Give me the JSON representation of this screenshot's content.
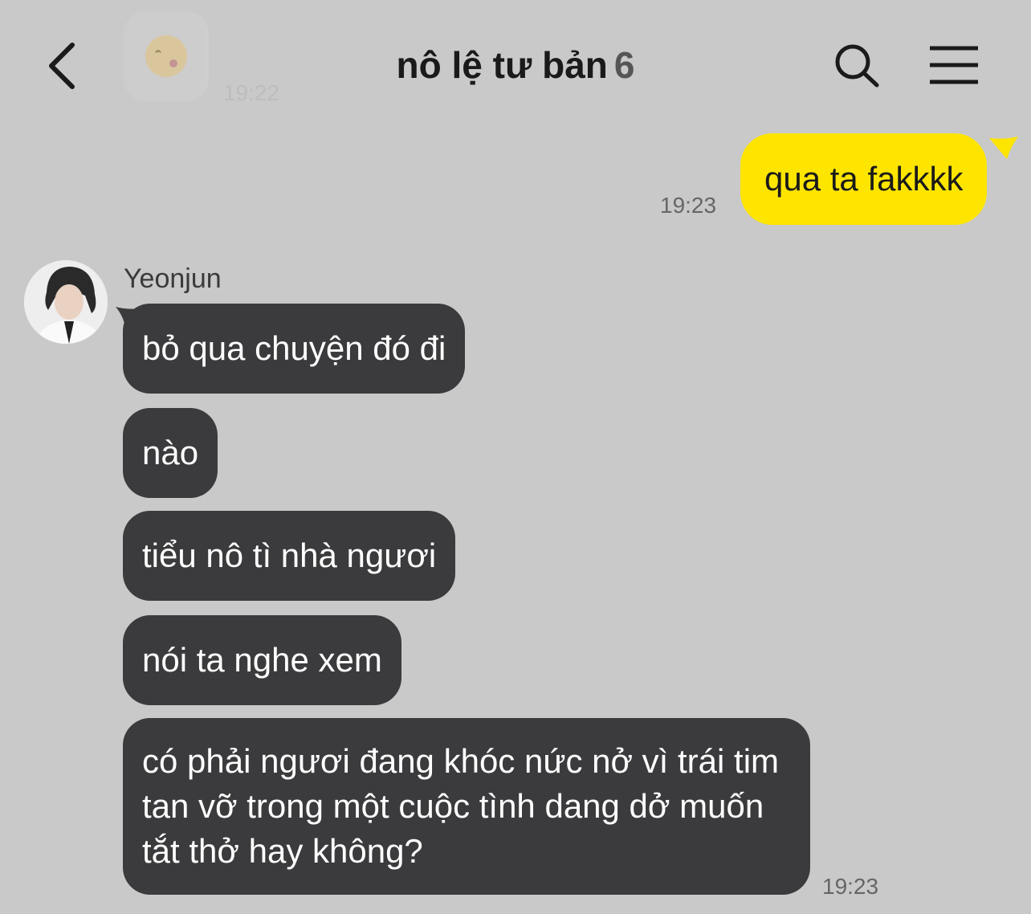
{
  "header": {
    "title": "nô lệ tư bản",
    "member_count": "6",
    "prev_time": "19:22"
  },
  "my_message": {
    "text": "qua ta fakkkk",
    "time": "19:23",
    "bubble_color": "#fee500"
  },
  "friend": {
    "name": "Yeonjun",
    "messages": [
      "bỏ qua chuyện đó đi",
      "nào",
      "tiểu nô tì nhà ngươi",
      "nói ta nghe xem",
      "có phải ngươi đang khóc nức nở vì trái tim tan vỡ trong một cuộc tình dang dở muốn tắt thở hay không?"
    ],
    "time": "19:23",
    "bubble_color": "#3b3b3d"
  }
}
